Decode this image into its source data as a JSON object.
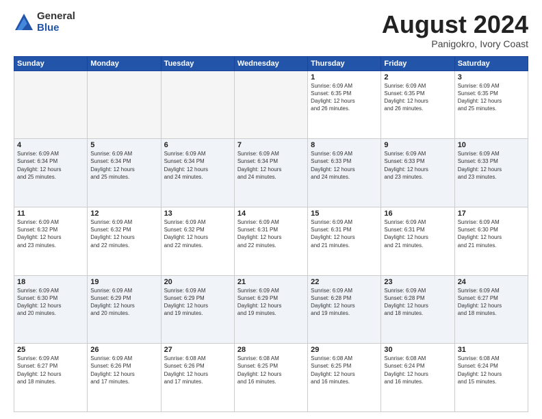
{
  "logo": {
    "general": "General",
    "blue": "Blue"
  },
  "title": "August 2024",
  "subtitle": "Panigokro, Ivory Coast",
  "headers": [
    "Sunday",
    "Monday",
    "Tuesday",
    "Wednesday",
    "Thursday",
    "Friday",
    "Saturday"
  ],
  "weeks": [
    [
      {
        "day": "",
        "info": ""
      },
      {
        "day": "",
        "info": ""
      },
      {
        "day": "",
        "info": ""
      },
      {
        "day": "",
        "info": ""
      },
      {
        "day": "1",
        "info": "Sunrise: 6:09 AM\nSunset: 6:35 PM\nDaylight: 12 hours\nand 26 minutes."
      },
      {
        "day": "2",
        "info": "Sunrise: 6:09 AM\nSunset: 6:35 PM\nDaylight: 12 hours\nand 26 minutes."
      },
      {
        "day": "3",
        "info": "Sunrise: 6:09 AM\nSunset: 6:35 PM\nDaylight: 12 hours\nand 25 minutes."
      }
    ],
    [
      {
        "day": "4",
        "info": "Sunrise: 6:09 AM\nSunset: 6:34 PM\nDaylight: 12 hours\nand 25 minutes."
      },
      {
        "day": "5",
        "info": "Sunrise: 6:09 AM\nSunset: 6:34 PM\nDaylight: 12 hours\nand 25 minutes."
      },
      {
        "day": "6",
        "info": "Sunrise: 6:09 AM\nSunset: 6:34 PM\nDaylight: 12 hours\nand 24 minutes."
      },
      {
        "day": "7",
        "info": "Sunrise: 6:09 AM\nSunset: 6:34 PM\nDaylight: 12 hours\nand 24 minutes."
      },
      {
        "day": "8",
        "info": "Sunrise: 6:09 AM\nSunset: 6:33 PM\nDaylight: 12 hours\nand 24 minutes."
      },
      {
        "day": "9",
        "info": "Sunrise: 6:09 AM\nSunset: 6:33 PM\nDaylight: 12 hours\nand 23 minutes."
      },
      {
        "day": "10",
        "info": "Sunrise: 6:09 AM\nSunset: 6:33 PM\nDaylight: 12 hours\nand 23 minutes."
      }
    ],
    [
      {
        "day": "11",
        "info": "Sunrise: 6:09 AM\nSunset: 6:32 PM\nDaylight: 12 hours\nand 23 minutes."
      },
      {
        "day": "12",
        "info": "Sunrise: 6:09 AM\nSunset: 6:32 PM\nDaylight: 12 hours\nand 22 minutes."
      },
      {
        "day": "13",
        "info": "Sunrise: 6:09 AM\nSunset: 6:32 PM\nDaylight: 12 hours\nand 22 minutes."
      },
      {
        "day": "14",
        "info": "Sunrise: 6:09 AM\nSunset: 6:31 PM\nDaylight: 12 hours\nand 22 minutes."
      },
      {
        "day": "15",
        "info": "Sunrise: 6:09 AM\nSunset: 6:31 PM\nDaylight: 12 hours\nand 21 minutes."
      },
      {
        "day": "16",
        "info": "Sunrise: 6:09 AM\nSunset: 6:31 PM\nDaylight: 12 hours\nand 21 minutes."
      },
      {
        "day": "17",
        "info": "Sunrise: 6:09 AM\nSunset: 6:30 PM\nDaylight: 12 hours\nand 21 minutes."
      }
    ],
    [
      {
        "day": "18",
        "info": "Sunrise: 6:09 AM\nSunset: 6:30 PM\nDaylight: 12 hours\nand 20 minutes."
      },
      {
        "day": "19",
        "info": "Sunrise: 6:09 AM\nSunset: 6:29 PM\nDaylight: 12 hours\nand 20 minutes."
      },
      {
        "day": "20",
        "info": "Sunrise: 6:09 AM\nSunset: 6:29 PM\nDaylight: 12 hours\nand 19 minutes."
      },
      {
        "day": "21",
        "info": "Sunrise: 6:09 AM\nSunset: 6:29 PM\nDaylight: 12 hours\nand 19 minutes."
      },
      {
        "day": "22",
        "info": "Sunrise: 6:09 AM\nSunset: 6:28 PM\nDaylight: 12 hours\nand 19 minutes."
      },
      {
        "day": "23",
        "info": "Sunrise: 6:09 AM\nSunset: 6:28 PM\nDaylight: 12 hours\nand 18 minutes."
      },
      {
        "day": "24",
        "info": "Sunrise: 6:09 AM\nSunset: 6:27 PM\nDaylight: 12 hours\nand 18 minutes."
      }
    ],
    [
      {
        "day": "25",
        "info": "Sunrise: 6:09 AM\nSunset: 6:27 PM\nDaylight: 12 hours\nand 18 minutes."
      },
      {
        "day": "26",
        "info": "Sunrise: 6:09 AM\nSunset: 6:26 PM\nDaylight: 12 hours\nand 17 minutes."
      },
      {
        "day": "27",
        "info": "Sunrise: 6:08 AM\nSunset: 6:26 PM\nDaylight: 12 hours\nand 17 minutes."
      },
      {
        "day": "28",
        "info": "Sunrise: 6:08 AM\nSunset: 6:25 PM\nDaylight: 12 hours\nand 16 minutes."
      },
      {
        "day": "29",
        "info": "Sunrise: 6:08 AM\nSunset: 6:25 PM\nDaylight: 12 hours\nand 16 minutes."
      },
      {
        "day": "30",
        "info": "Sunrise: 6:08 AM\nSunset: 6:24 PM\nDaylight: 12 hours\nand 16 minutes."
      },
      {
        "day": "31",
        "info": "Sunrise: 6:08 AM\nSunset: 6:24 PM\nDaylight: 12 hours\nand 15 minutes."
      }
    ]
  ]
}
